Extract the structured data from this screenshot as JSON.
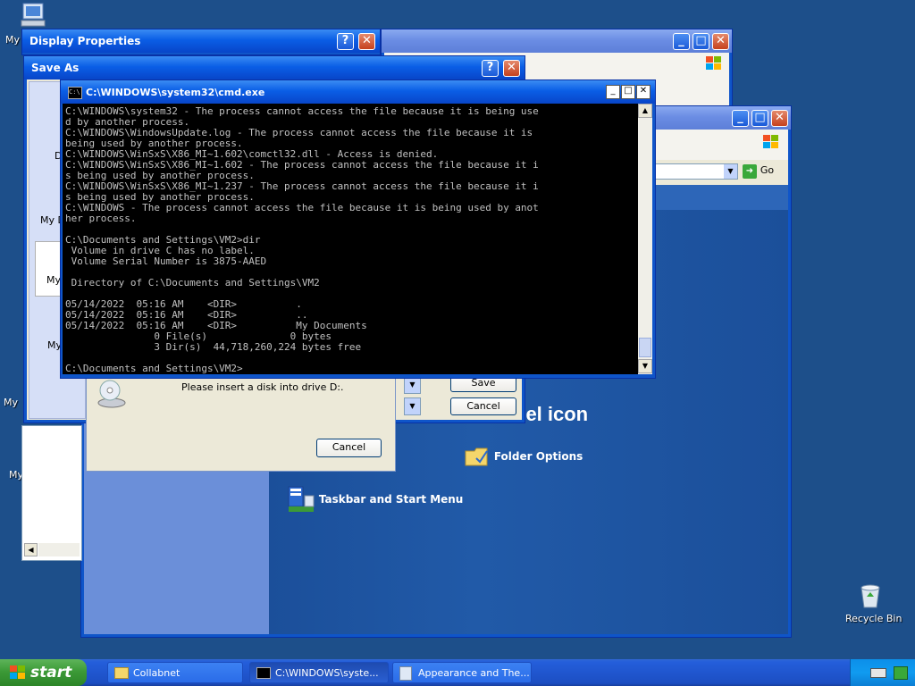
{
  "desktop": {
    "icons": {
      "my_computer": "My",
      "my_left_1": "My",
      "my_left_2": "My",
      "recycle_bin": "Recycle Bin"
    }
  },
  "display_properties": {
    "title": "Display Properties",
    "help": "?",
    "close": "✕"
  },
  "save_as": {
    "title": "Save As",
    "help": "?",
    "close": "✕",
    "save_label": "Save",
    "cancel_label": "Cancel",
    "left_labels": [
      "D",
      "My D",
      "My",
      "My"
    ]
  },
  "cmd": {
    "title": "C:\\WINDOWS\\system32\\cmd.exe",
    "lines": "C:\\WINDOWS\\system32 - The process cannot access the file because it is being use\nd by another process.\nC:\\WINDOWS\\WindowsUpdate.log - The process cannot access the file because it is\nbeing used by another process.\nC:\\WINDOWS\\WinSxS\\X86_MI~1.602\\comctl32.dll - Access is denied.\nC:\\WINDOWS\\WinSxS\\X86_MI~1.602 - The process cannot access the file because it i\ns being used by another process.\nC:\\WINDOWS\\WinSxS\\X86_MI~1.237 - The process cannot access the file because it i\ns being used by another process.\nC:\\WINDOWS - The process cannot access the file because it is being used by anot\nher process.\n\nC:\\Documents and Settings\\VM2>dir\n Volume in drive C has no label.\n Volume Serial Number is 3875-AAED\n\n Directory of C:\\Documents and Settings\\VM2\n\n05/14/2022  05:16 AM    <DIR>          .\n05/14/2022  05:16 AM    <DIR>          ..\n05/14/2022  05:16 AM    <DIR>          My Documents\n               0 File(s)              0 bytes\n               3 Dir(s)  44,718,260,224 bytes free\n\nC:\\Documents and Settings\\VM2>"
  },
  "disk_dialog": {
    "message": "Please insert a disk into drive D:.",
    "cancel_label": "Cancel"
  },
  "control_panel": {
    "heading": "nel icon",
    "items": [
      "Folder Options",
      "Taskbar and Start Menu"
    ],
    "go_label": "Go"
  },
  "taskbar": {
    "start_label": "start",
    "buttons": [
      "Collabnet",
      "C:\\WINDOWS\\syste...",
      "Appearance and The..."
    ]
  },
  "colors": {
    "desktop": "#1d4f8a",
    "xp_blue": "#0a5ee6",
    "start_green": "#3c9a37"
  }
}
